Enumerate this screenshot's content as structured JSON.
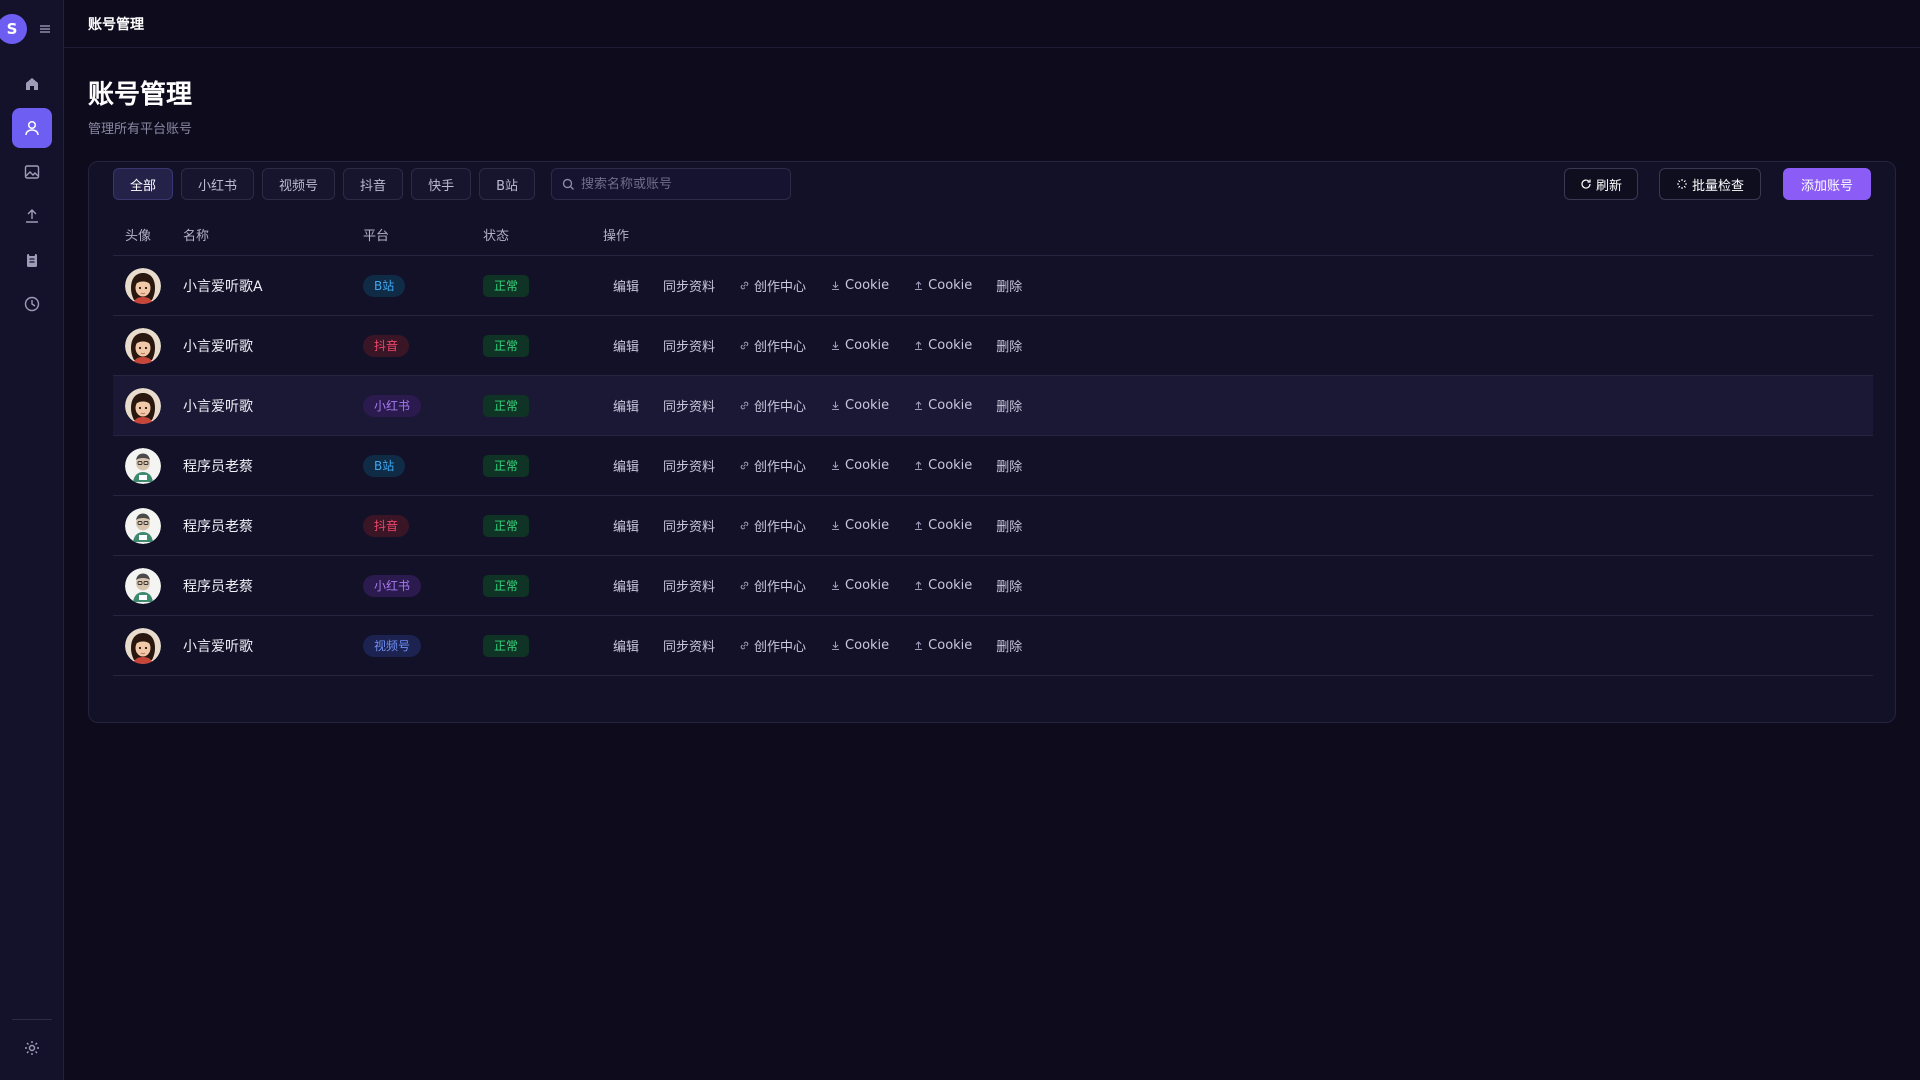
{
  "app": {
    "logo_letter": "S",
    "topbar_title": "账号管理"
  },
  "page": {
    "title": "账号管理",
    "subtitle": "管理所有平台账号"
  },
  "filters": {
    "tabs": [
      "全部",
      "小红书",
      "视频号",
      "抖音",
      "快手",
      "B站"
    ],
    "active": "全部"
  },
  "search": {
    "placeholder": "搜索名称或账号",
    "value": ""
  },
  "toolbar": {
    "refresh_label": "刷新",
    "batch_check_label": "批量检查",
    "add_label": "添加账号"
  },
  "table": {
    "headers": {
      "avatar": "头像",
      "name": "名称",
      "platform": "平台",
      "status": "状态",
      "actions": "操作"
    },
    "actions": {
      "edit": "编辑",
      "sync": "同步资料",
      "creator": "创作中心",
      "cookie_download": "Cookie",
      "cookie_upload": "Cookie",
      "delete": "删除"
    },
    "rows": [
      {
        "avatar": "girl-avatar",
        "name": "小言爱听歌A",
        "platform": "B站",
        "platform_style": "bili",
        "status": "正常"
      },
      {
        "avatar": "girl-avatar",
        "name": "小言爱听歌",
        "platform": "抖音",
        "platform_style": "douyin",
        "status": "正常"
      },
      {
        "avatar": "girl-avatar",
        "name": "小言爱听歌",
        "platform": "小红书",
        "platform_style": "xhs",
        "status": "正常"
      },
      {
        "avatar": "coder-avatar",
        "name": "程序员老蔡",
        "platform": "B站",
        "platform_style": "bili",
        "status": "正常"
      },
      {
        "avatar": "coder-avatar",
        "name": "程序员老蔡",
        "platform": "抖音",
        "platform_style": "douyin",
        "status": "正常"
      },
      {
        "avatar": "coder-avatar",
        "name": "程序员老蔡",
        "platform": "小红书",
        "platform_style": "xhs",
        "status": "正常"
      },
      {
        "avatar": "girl-avatar",
        "name": "小言爱听歌",
        "platform": "视频号",
        "platform_style": "sph",
        "status": "正常"
      }
    ]
  },
  "colors": {
    "accent": "#8b5cf6",
    "nav_active": "#6f5ef2",
    "background": "#0d0b1c",
    "status_ok": "#34d27a"
  },
  "icons": {
    "nav": [
      "home-icon",
      "user-icon",
      "image-icon",
      "upload-icon",
      "clipboard-icon",
      "clock-icon"
    ],
    "footer": "settings-icon"
  }
}
